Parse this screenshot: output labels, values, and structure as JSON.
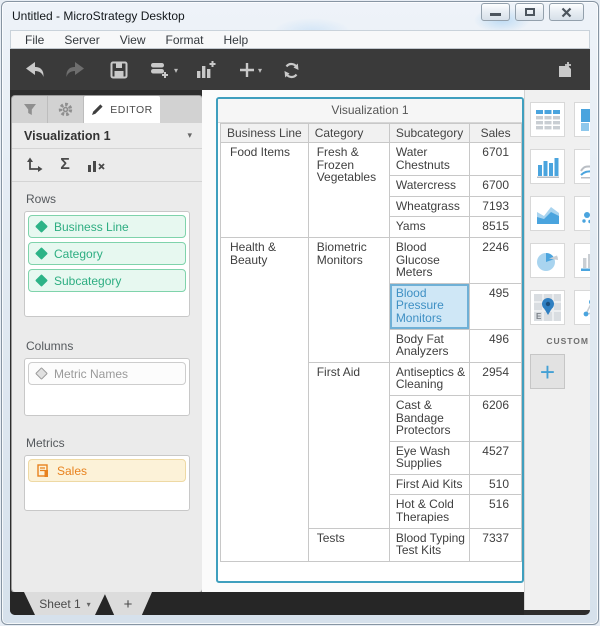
{
  "window": {
    "title": "Untitled - MicroStrategy Desktop",
    "controls": [
      "minimize-button",
      "restore-button",
      "close-button"
    ]
  },
  "menu": {
    "items": [
      "File",
      "Server",
      "View",
      "Format",
      "Help"
    ]
  },
  "toolbar": {
    "icons": [
      "back-icon",
      "forward-icon",
      "save-icon",
      "add-data-icon",
      "add-visualization-icon",
      "add-icon",
      "refresh-icon",
      "new-dossier-page-icon"
    ]
  },
  "editor": {
    "tabs": [
      {
        "icon": "filter-icon"
      },
      {
        "icon": "gear-icon"
      },
      {
        "icon": "pencil-icon",
        "label": "EDITOR",
        "active": true
      }
    ],
    "visualization_name": "Visualization 1",
    "tool_icons": [
      "swap-axes-icon",
      "sigma-icon",
      "remove-chart-icon"
    ],
    "sections": [
      {
        "label": "Rows",
        "items": [
          {
            "label": "Business Line",
            "type": "attribute"
          },
          {
            "label": "Category",
            "type": "attribute"
          },
          {
            "label": "Subcategory",
            "type": "attribute"
          }
        ]
      },
      {
        "label": "Columns",
        "items": [
          {
            "label": "Metric Names",
            "type": "placeholder"
          }
        ]
      },
      {
        "label": "Metrics",
        "items": [
          {
            "label": "Sales",
            "type": "metric"
          }
        ]
      }
    ]
  },
  "visualization": {
    "title": "Visualization 1",
    "table": {
      "columns": [
        "Business Line",
        "Category",
        "Subcategory",
        "Sales"
      ],
      "groups": [
        {
          "business_line": "Food Items",
          "categories": [
            {
              "category": "Fresh & Frozen Vegetables",
              "items": [
                {
                  "subcategory": "Water Chestnuts",
                  "sales": 6701
                },
                {
                  "subcategory": "Watercress",
                  "sales": 6700
                },
                {
                  "subcategory": "Wheatgrass",
                  "sales": 7193
                },
                {
                  "subcategory": "Yams",
                  "sales": 8515
                }
              ]
            }
          ]
        },
        {
          "business_line": "Health & Beauty",
          "categories": [
            {
              "category": "Biometric Monitors",
              "items": [
                {
                  "subcategory": "Blood Glucose Meters",
                  "sales": 2246
                },
                {
                  "subcategory": "Blood Pressure Monitors",
                  "sales": 495,
                  "selected": true
                },
                {
                  "subcategory": "Body Fat Analyzers",
                  "sales": 496
                }
              ]
            },
            {
              "category": "First Aid",
              "items": [
                {
                  "subcategory": "Antiseptics & Cleaning",
                  "sales": 2954
                },
                {
                  "subcategory": "Cast & Bandage Protectors",
                  "sales": 6206
                },
                {
                  "subcategory": "Eye Wash Supplies",
                  "sales": 4527
                },
                {
                  "subcategory": "First Aid Kits",
                  "sales": 510
                },
                {
                  "subcategory": "Hot & Cold Therapies",
                  "sales": 516
                }
              ]
            },
            {
              "category": "Tests",
              "items": [
                {
                  "subcategory": "Blood Typing Test Kits",
                  "sales": 7337
                }
              ]
            }
          ]
        }
      ]
    }
  },
  "gallery": {
    "custom_label": "CUSTOM",
    "icons": [
      "grid-icon",
      "heat-map-icon",
      "bar-chart-icon",
      "line-chart-icon",
      "area-chart-icon",
      "bubble-chart-icon",
      "pie-chart-icon",
      "combo-chart-icon",
      "map-icon",
      "network-icon",
      "add-custom-visual-icon"
    ]
  },
  "sheet_bar": {
    "sheet_label": "Sheet 1",
    "add_label": "+"
  },
  "colors": {
    "attribute_green": "#2eae82",
    "metric_orange": "#e8821e",
    "selection_blue": "#3f90c4",
    "viz_border_teal": "#3f9fbe",
    "gallery_icon_blue": "#4aa4de",
    "toolbar_dark": "#3a3a3a"
  }
}
